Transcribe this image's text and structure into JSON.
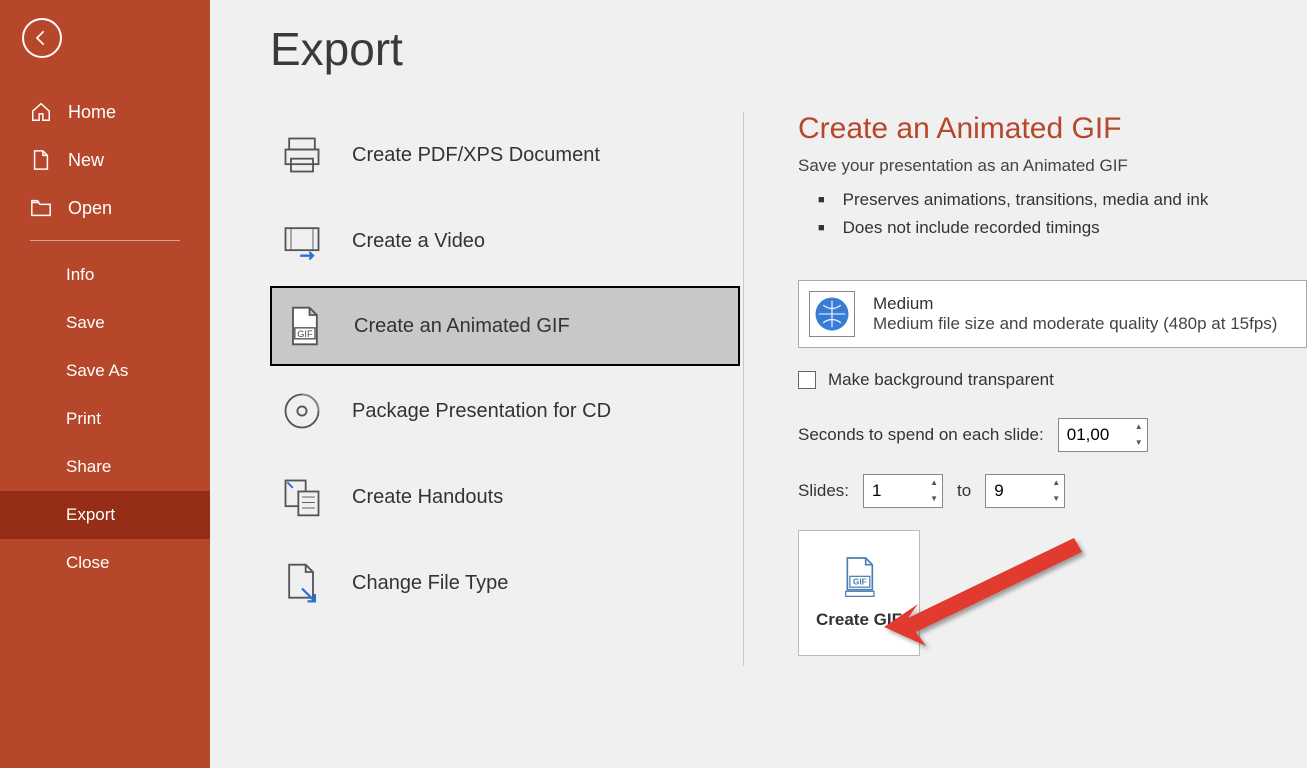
{
  "sidebar": {
    "items": [
      {
        "label": "Home"
      },
      {
        "label": "New"
      },
      {
        "label": "Open"
      },
      {
        "label": "Info"
      },
      {
        "label": "Save"
      },
      {
        "label": "Save As"
      },
      {
        "label": "Print"
      },
      {
        "label": "Share"
      },
      {
        "label": "Export"
      },
      {
        "label": "Close"
      }
    ]
  },
  "page": {
    "title": "Export"
  },
  "options": [
    {
      "label": "Create PDF/XPS Document"
    },
    {
      "label": "Create a Video"
    },
    {
      "label": "Create an Animated GIF"
    },
    {
      "label": "Package Presentation for CD"
    },
    {
      "label": "Create Handouts"
    },
    {
      "label": "Change File Type"
    }
  ],
  "details": {
    "title": "Create an Animated GIF",
    "subtitle": "Save your presentation as an Animated GIF",
    "bullets": [
      "Preserves animations, transitions, media and ink",
      "Does not include recorded timings"
    ],
    "quality": {
      "name": "Medium",
      "desc": "Medium file size and moderate quality (480p at 15fps)"
    },
    "transparent_label": "Make background transparent",
    "seconds_label": "Seconds to spend on each slide:",
    "seconds_value": "01,00",
    "slides_label": "Slides:",
    "slides_from": "1",
    "slides_to_label": "to",
    "slides_to": "9",
    "create_button": "Create GIF"
  }
}
